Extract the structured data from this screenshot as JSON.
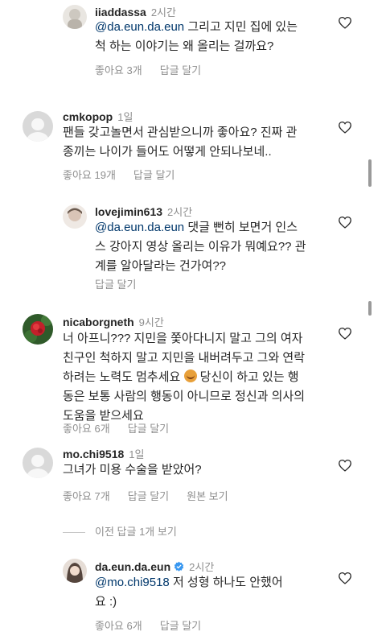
{
  "comments": [
    {
      "username": "iiaddassa",
      "time": "2시간",
      "mention": "@da.eun.da.eun",
      "line1_rest": " 그리고 지민 집에 있는",
      "line2": "척 하는 이야기는 왜 올리는 걸까요?",
      "likes": "좋아요 3개",
      "reply": "답글 달기"
    },
    {
      "username": "cmkopop",
      "time": "1일",
      "line1": "팬들 갖고놀면서 관심받으니까 좋아요? 진짜 관",
      "line2": "종끼는 나이가 들어도 어떻게 안되나보네..",
      "likes": "좋아요 19개",
      "reply": "답글 달기"
    },
    {
      "username": "lovejimin613",
      "time": "2시간",
      "mention": "@da.eun.da.eun",
      "line1_rest": " 댓글 뻔히 보면거 인스",
      "line2": "스 강아지 영상 올리는 이유가 뭐예요?? 관",
      "line3": "계를 알아달라는 건가여??",
      "reply": "답글 달기"
    },
    {
      "username": "nicaborgneth",
      "time": "9시간",
      "line1": "너 아프니??? 지민을 쫓아다니지 말고 그의 여자",
      "line2": "친구인 척하지 말고 지민을 내버려두고 그와 연락",
      "line3_a": "하려는 노력도 멈추세요 ",
      "line3_b": " 당신이 하고 있는 행",
      "line4": "동은 보통 사람의 행동이 아니므로 정신과 의사의",
      "line5": "도움을 받으세요",
      "likes": "좋아요 6개",
      "reply": "답글 달기"
    },
    {
      "username": "mo.chi9518",
      "time": "1일",
      "line1": "그녀가 미용 수술을 받았어?",
      "likes": "좋아요 7개",
      "reply": "답글 달기",
      "original": "원본 보기"
    },
    {
      "username": "da.eun.da.eun",
      "time": "2시간",
      "mention": "@mo.chi9518",
      "line1_rest": " 저 성형 하나도 안했어",
      "line2": "요 :)",
      "likes": "좋아요 6개",
      "reply": "답글 달기"
    }
  ],
  "more_replies": "이전 답글 1개 보기",
  "colors": {
    "mention": "#00376b",
    "meta": "#8e8e8e",
    "verified": "#3897f0"
  },
  "icons": [
    "heart-icon",
    "verified-badge-icon",
    "default-avatar-icon"
  ]
}
